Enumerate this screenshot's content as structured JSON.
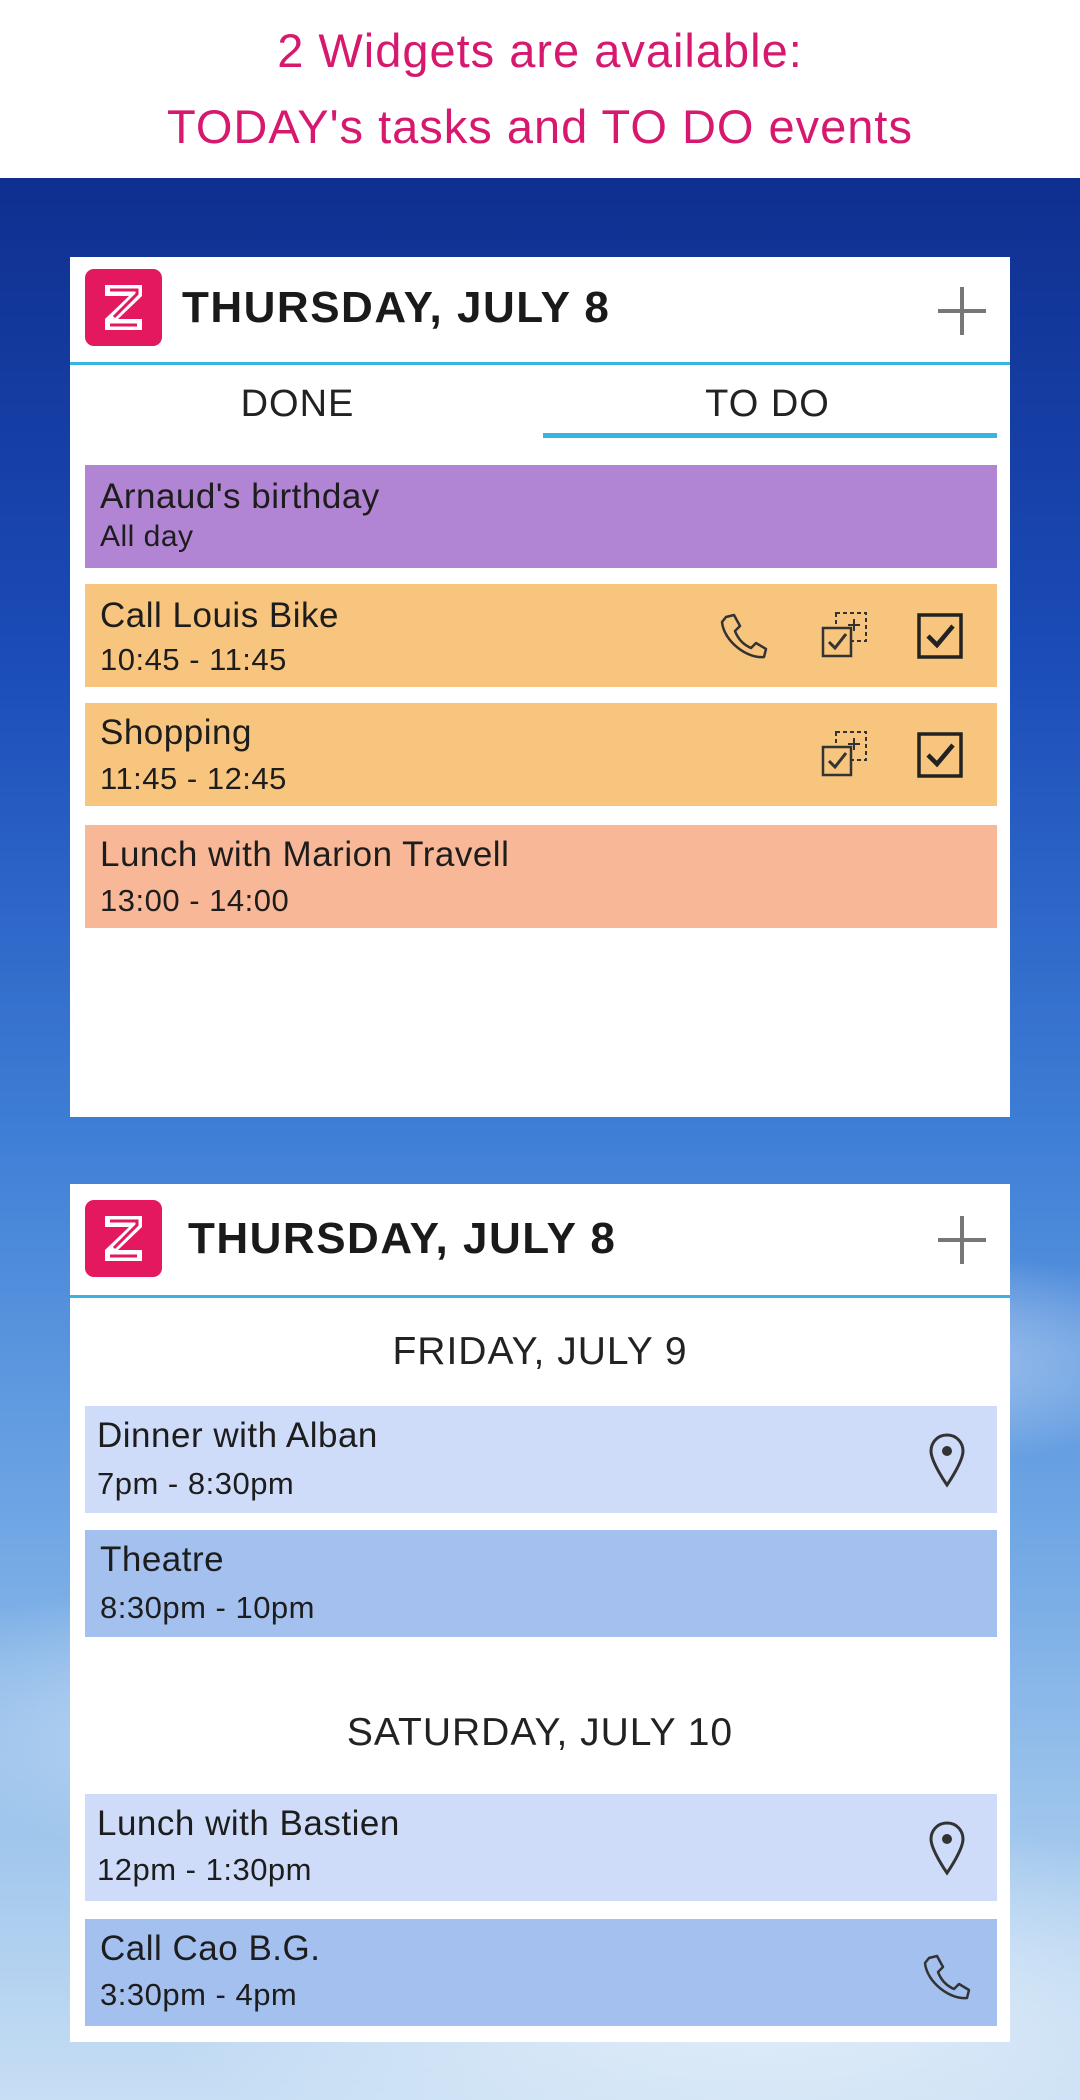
{
  "banner": {
    "line1": "2 Widgets are available:",
    "line2": "TODAY's tasks and TO DO events",
    "color": "#d6186e"
  },
  "widget_today": {
    "title": "THURSDAY, JULY 8",
    "add_icon": "plus-icon",
    "tabs": [
      {
        "label": "DONE",
        "selected": false
      },
      {
        "label": "TO DO",
        "selected": true
      }
    ],
    "events": [
      {
        "title": "Arnaud's birthday",
        "time": "All day",
        "color": "#b285d4"
      },
      {
        "title": "Call Louis Bike",
        "time": "10:45 - 11:45",
        "color": "#f8c57f",
        "icons": [
          "phone-icon",
          "copy-task-icon",
          "checkbox-checked-icon"
        ]
      },
      {
        "title": "Shopping",
        "time": "11:45 - 12:45",
        "color": "#f8c57f",
        "icons": [
          "copy-task-icon",
          "checkbox-checked-icon"
        ]
      },
      {
        "title": "Lunch with Marion Travell",
        "time": "13:00 - 14:00",
        "color": "#f8b898"
      }
    ]
  },
  "widget_todo": {
    "title": "THURSDAY, JULY 8",
    "add_icon": "plus-icon",
    "days": [
      {
        "heading": "FRIDAY, JULY 9",
        "events": [
          {
            "title": "Dinner with Alban",
            "time": "7pm - 8:30pm",
            "color": "#cfdcf9",
            "icon": "location-pin-icon"
          },
          {
            "title": "Theatre",
            "time": "8:30pm - 10pm",
            "color": "#a3c0ef"
          }
        ]
      },
      {
        "heading": "SATURDAY, JULY 10",
        "events": [
          {
            "title": "Lunch with Bastien",
            "time": "12pm - 1:30pm",
            "color": "#cfdcf9",
            "icon": "location-pin-icon"
          },
          {
            "title": "Call Cao B.G.",
            "time": "3:30pm - 4pm",
            "color": "#a3c0ef",
            "icon": "phone-icon"
          }
        ]
      }
    ]
  },
  "accent_color": "#38b4e0",
  "logo_color": "#e3185f"
}
